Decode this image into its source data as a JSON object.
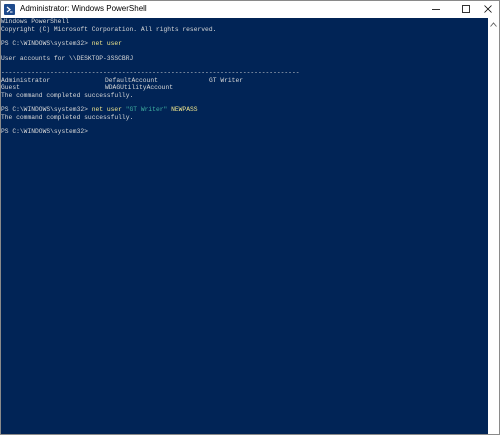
{
  "window": {
    "title": "Administrator: Windows PowerShell"
  },
  "console": {
    "banner_1": "Windows PowerShell",
    "banner_2": "Copyright (C) Microsoft Corporation. All rights reserved.",
    "prompt": "PS C:\\WINDOWS\\system32> ",
    "command_1": "net user",
    "accounts_header": "User accounts for \\\\DESKTOP-3SSCBRJ",
    "separator": "-------------------------------------------------------------------------------",
    "accounts": [
      [
        "Administrator",
        "DefaultAccount",
        "GT Writer"
      ],
      [
        "Guest",
        "WDAGUtilityAccount",
        ""
      ]
    ],
    "completed": "The command completed successfully.",
    "command_2_prefix": "net user ",
    "command_2_string": "\"GT Writer\"",
    "command_2_suffix": " NEWPASS"
  },
  "colors": {
    "console_background": "#012456",
    "console_text": "#d8d8d8",
    "command_text": "#f0e68c",
    "string_text": "#40b0a0"
  },
  "icons": {
    "app": "powershell-icon",
    "minimize": "minimize-icon",
    "maximize": "maximize-icon",
    "close": "close-icon",
    "scroll_up": "chevron-up-icon"
  }
}
